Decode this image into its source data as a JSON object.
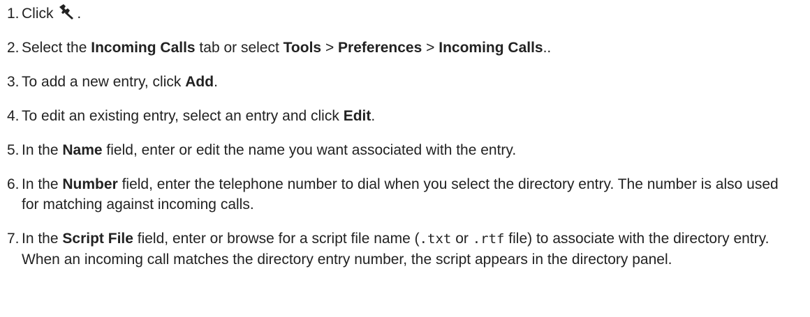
{
  "steps": [
    {
      "num": "1.",
      "text1": "Click ",
      "icon": "wrench-icon",
      "text2": "."
    },
    {
      "num": "2.",
      "t1": "Select the ",
      "b1": "Incoming Calls",
      "t2": " tab or select ",
      "b2": "Tools",
      "t3": " > ",
      "b3": "Preferences",
      "t4": " > ",
      "b4": "Incoming Calls",
      "t5": ".."
    },
    {
      "num": "3.",
      "t1": "To add a new entry, click ",
      "b1": "Add",
      "t2": "."
    },
    {
      "num": "4.",
      "t1": "To edit an existing entry, select an entry and click ",
      "b1": "Edit",
      "t2": "."
    },
    {
      "num": "5.",
      "t1": "In the ",
      "b1": "Name",
      "t2": " field, enter or edit the name you want associated with the entry."
    },
    {
      "num": "6.",
      "t1": "In the ",
      "b1": "Number",
      "t2": " field, enter the telephone number to dial when you select the directory entry. The number is also used for matching against incoming calls."
    },
    {
      "num": "7.",
      "t1": "In the ",
      "b1": "Script File",
      "t2": " field, enter or browse for a script file name (",
      "c1": ".txt",
      "t3": " or ",
      "c2": ".rtf",
      "t4": " file) to associate with the directory entry. When an incoming call matches the directory entry number, the script appears in the directory panel."
    }
  ]
}
